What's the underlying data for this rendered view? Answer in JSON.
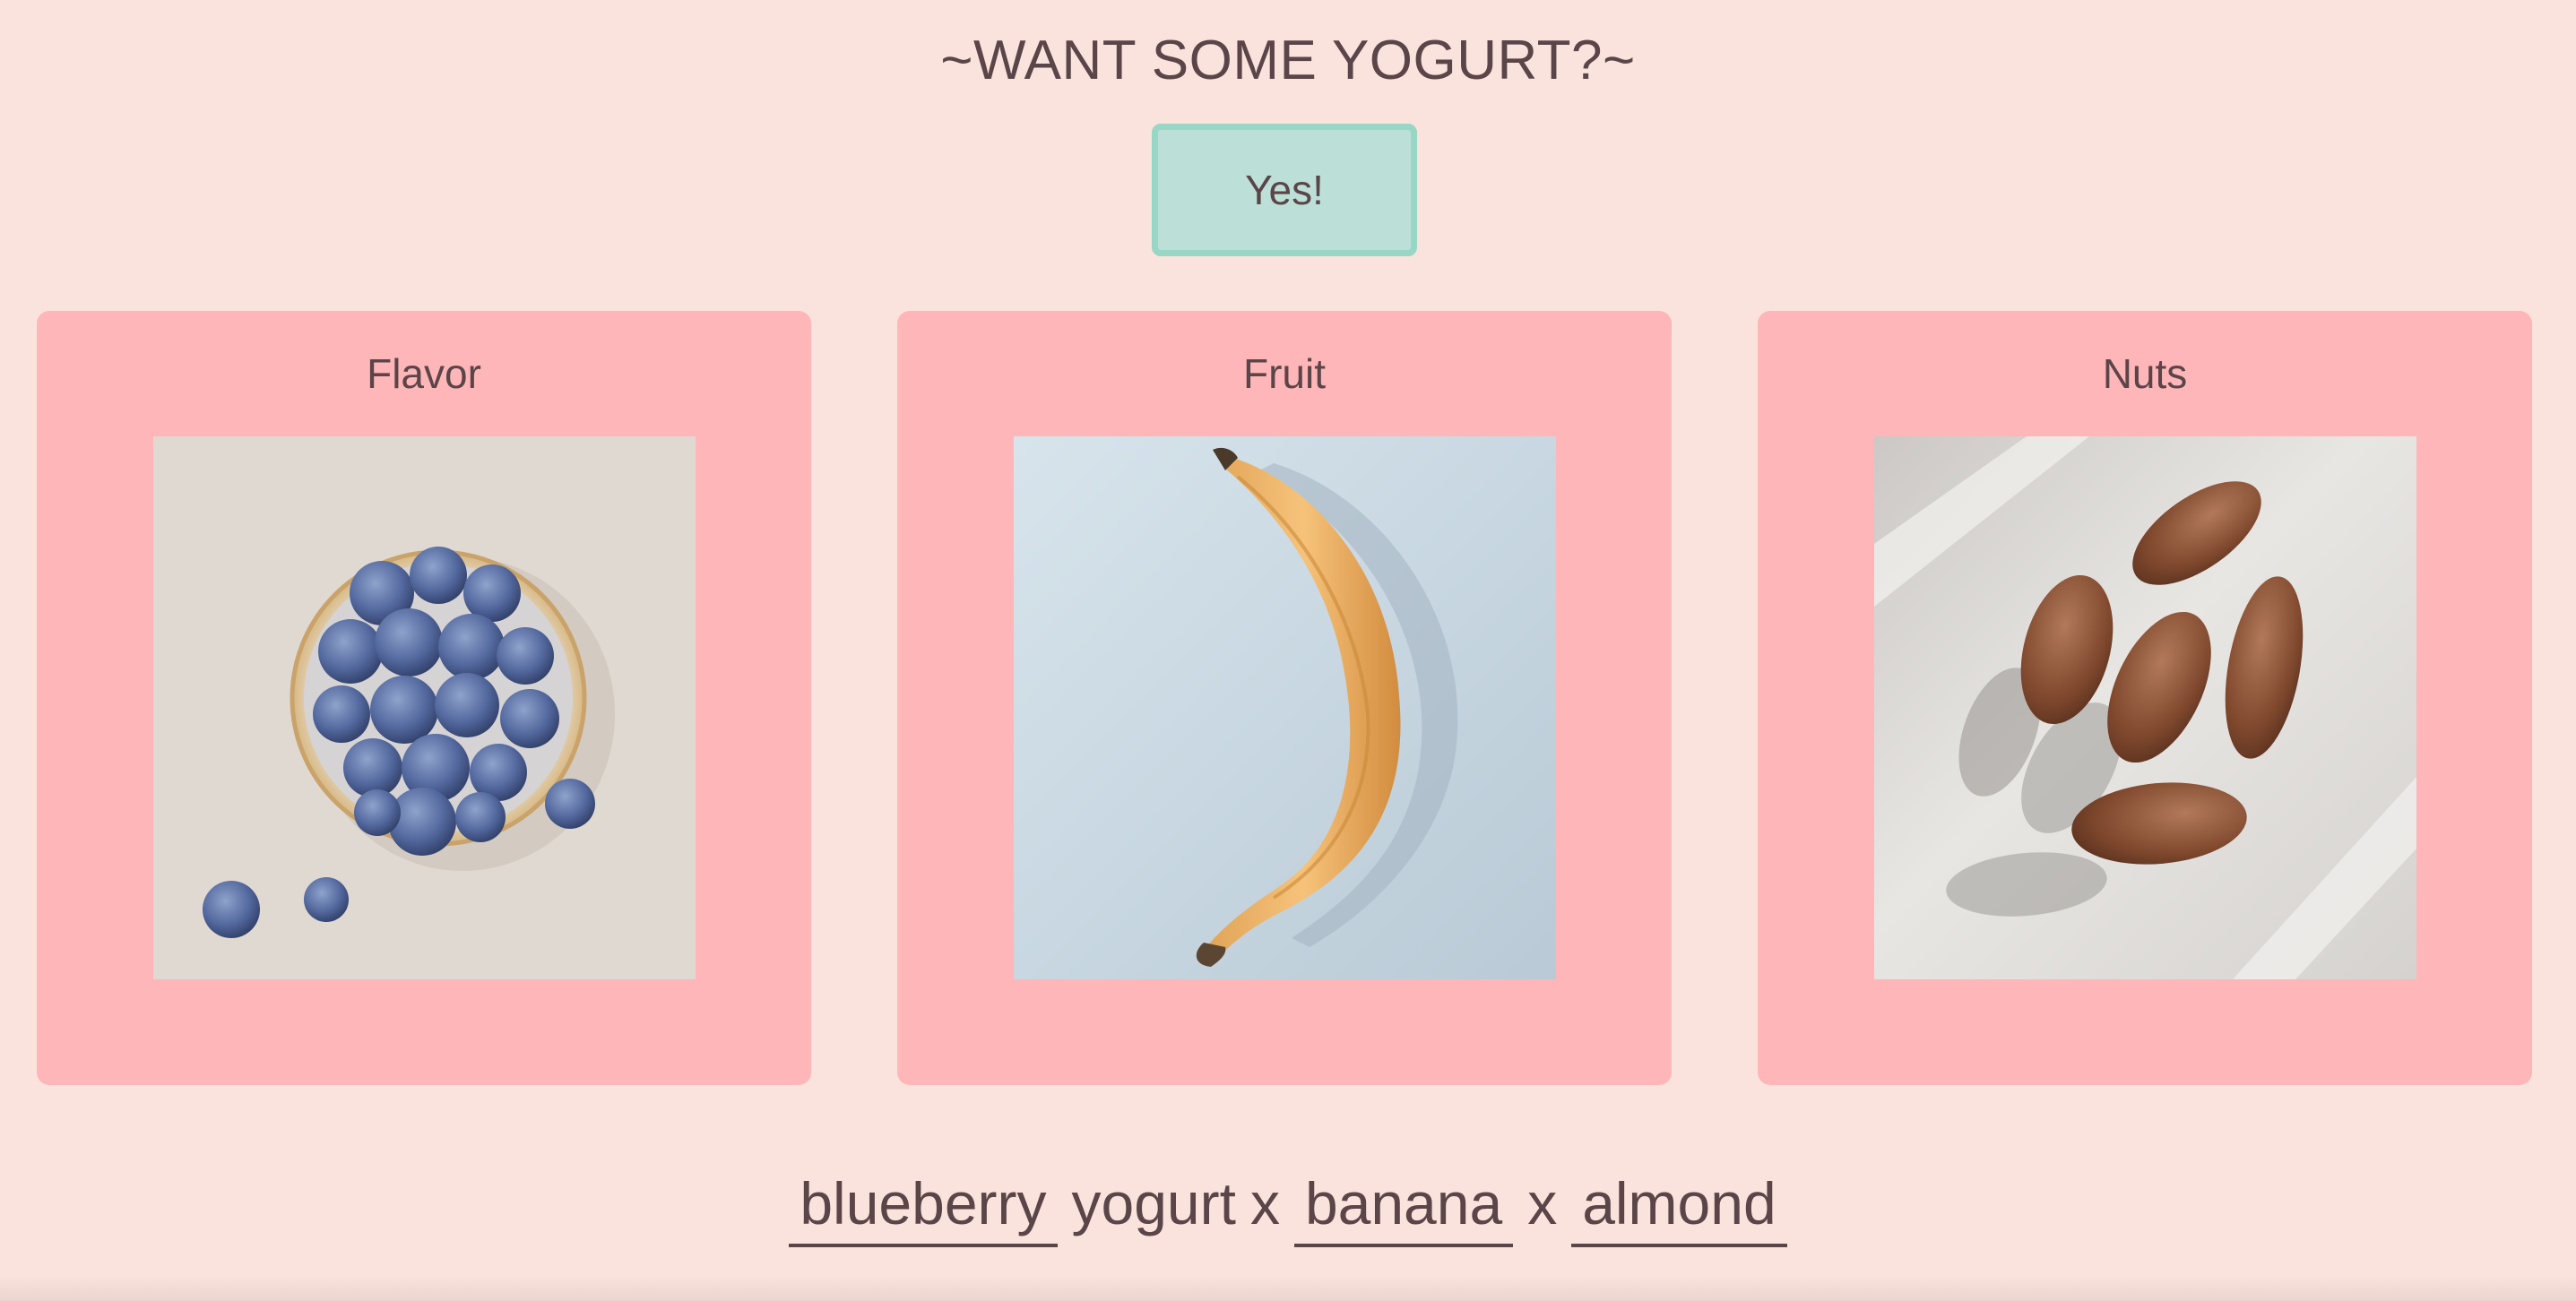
{
  "header": {
    "title": "~WANT SOME YOGURT?~",
    "yes_label": "Yes!"
  },
  "cards": [
    {
      "label": "Flavor",
      "image": "blueberries-in-glass-bowl"
    },
    {
      "label": "Fruit",
      "image": "banana"
    },
    {
      "label": "Nuts",
      "image": "almonds"
    }
  ],
  "sentence": {
    "flavor": "blueberry",
    "yogurt_word": "yogurt",
    "separator_1": "x",
    "fruit": "banana",
    "separator_2": "x",
    "nut": "almond"
  },
  "colors": {
    "background": "#fae3dc",
    "card": "#ffb6b8",
    "button_fill": "#bce0d8",
    "button_border": "#98d6c5",
    "text": "#5b4549"
  }
}
